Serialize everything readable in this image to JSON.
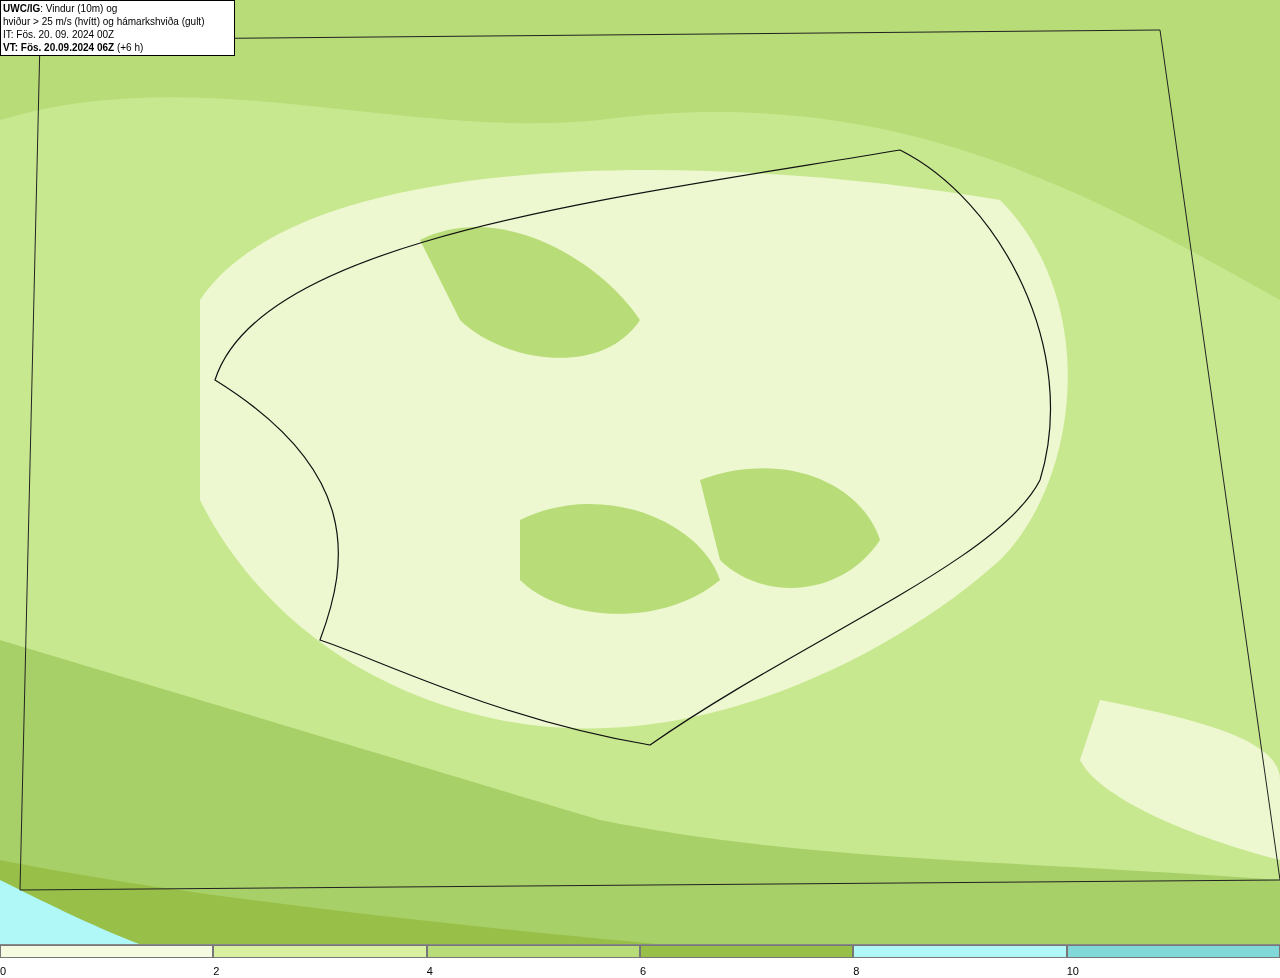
{
  "title_box": {
    "lines": [
      "**UWC/IG**: Vindur (10m) og",
      "hviður > 25 m/s (hvítt) og hámarkshviða (gult)",
      "IT: Fös. 20. 09. 2024 00Z",
      "**VT: Fös. 20.09.2024 06Z** (+6 h)"
    ]
  },
  "legend": [
    {
      "label": "0",
      "color": "#f4fbe0"
    },
    {
      "label": "2",
      "color": "#d8f0a0"
    },
    {
      "label": "4",
      "color": "#b8dc78"
    },
    {
      "label": "6",
      "color": "#98c048"
    },
    {
      "label": "8",
      "color": "#b0f8f8"
    },
    {
      "label": "10",
      "color": "#80d8d8"
    }
  ]
}
